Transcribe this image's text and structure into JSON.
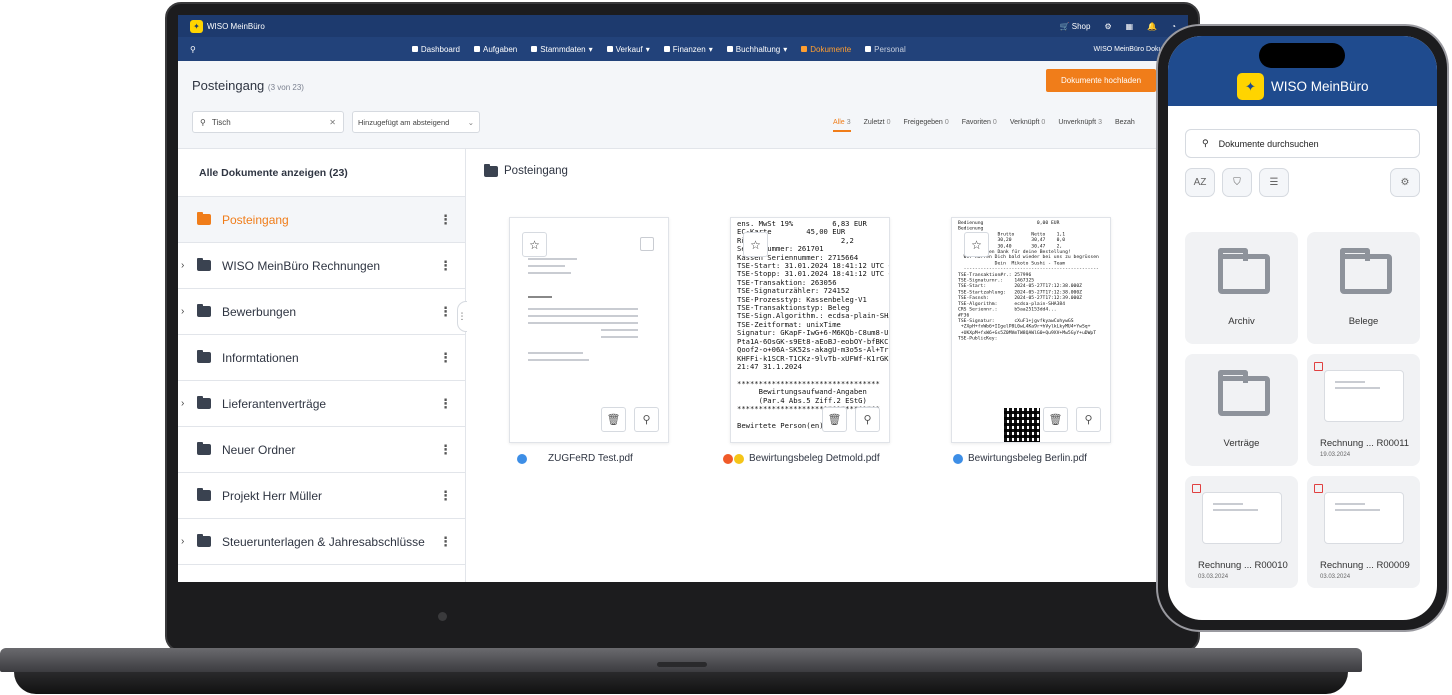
{
  "app": {
    "brand": "WISO MeinBüro",
    "shop": "Shop",
    "notif_count": "3"
  },
  "nav": {
    "items": [
      {
        "label": "Dashboard"
      },
      {
        "label": "Aufgaben"
      },
      {
        "label": "Stammdaten"
      },
      {
        "label": "Verkauf"
      },
      {
        "label": "Finanzen"
      },
      {
        "label": "Buchhaltung"
      },
      {
        "label": "Dokumente"
      },
      {
        "label": "Personal"
      }
    ],
    "right_label": "WISO MeinBüro Dokumen"
  },
  "header": {
    "title": "Posteingang",
    "count": "(3 von 23)",
    "upload_label": "Dokumente hochladen",
    "search_value": "Tisch",
    "sort_value": "Hinzugefügt am absteigend",
    "filters": [
      {
        "label": "Alle",
        "count": "3"
      },
      {
        "label": "Zuletzt",
        "count": "0"
      },
      {
        "label": "Freigegeben",
        "count": "0"
      },
      {
        "label": "Favoriten",
        "count": "0"
      },
      {
        "label": "Verknüpft",
        "count": "0"
      },
      {
        "label": "Unverknüpft",
        "count": "3"
      },
      {
        "label": "Bezah",
        "count": ""
      }
    ]
  },
  "folders": {
    "all_label": "Alle Dokumente anzeigen (23)",
    "items": [
      {
        "label": "Posteingang"
      },
      {
        "label": "WISO MeinBüro Rechnungen"
      },
      {
        "label": "Bewerbungen"
      },
      {
        "label": "Informtationen"
      },
      {
        "label": "Lieferantenverträge"
      },
      {
        "label": "Neuer Ordner"
      },
      {
        "label": "Projekt Herr Müller"
      },
      {
        "label": "Steuerunterlagen & Jahresabschlüsse"
      }
    ]
  },
  "documents": {
    "breadcrumb": "Posteingang",
    "items": [
      {
        "name": "ZUGFeRD Test.pdf",
        "tag_colors": [
          "#3d8ee6"
        ]
      },
      {
        "name": "Bewirtungsbeleg Detmold.pdf",
        "tag_colors": [
          "#f05a28",
          "#f5c518"
        ]
      },
      {
        "name": "Bewirtungsbeleg Berlin.pdf",
        "tag_colors": [
          "#3d8ee6"
        ]
      }
    ],
    "receipt1": "ens. MwSt 19%         6,83 EUR\nEC-Karte        45,00 EUR\nRü                      2,2\nSeriennummer: 261701\nKassen Seriennummer: 2715664\nTSE-Start: 31.01.2024 18:41:12 UTC +1:00\nTSE-Stopp: 31.01.2024 18:41:12 UTC +1:00\nTSE-Transaktion: 263056\nTSE-Signaturzähler: 724152\nTSE-Prozesstyp: Kassenbeleg-V1\nTSE-Transaktionstyp: Beleg\nTSE-Sign.Algorithm.: ecdsa-plain-SHA384\nTSE-Zeitformat: unixTime\nSignatur: GKapF-IwG+6-M6KQb-C8um8-Ucb1/-\nPta1A-6OsGK-s9Et8-aEoBJ-eobOY-bfBKC-nXKdF-\nQoof2-o+06A-SK52s-akagU-m3o5s-Al+Tr-UoFDY-\nKHFFi-k1SCR-T1CKz-9lvTb-xUFWf-K1rGK-3KN\n21:47 31.1.2024\n\n*********************************\n     Bewirtungsaufwand-Angaben\n     (Par.4 Abs.5 Ziff.2 EStG)\n*********************************\n\nBewirtete Person(en):",
    "receipt2": "Bedienung                   0,00 EUR\nBedienung\n              Brutto      Netto    1,1\n              30,20       30,47    0,0\n              30,40       30,47    2,\n       Vielen Dank für deine Bestellung!\n  Wir hoffen Dich bald wieder bei uns zu begrüssen\n             Dein  Mikoto Sushi - Team\n  ------------------------------------------------\nTSE-Transaktion#r.: 257996\nTSE-Signaturnr.:    1467325\nTSE-Start:          2024-05-27T17:12:38.000Z\nTSE-Startzahlung:   2024-05-27T17:12:38.000Z\nTSE-Fasnsh:         2024-05-27T17:12:39.000Z\nTSE-Algorithm:      ecdsa-plain-SHA384\nCRS Seriennr.:      b5aa25153dd4...\n#F36\nTSE-Signatur:       cXuF1+jgvfkyawCohywGS\n +ZXpH+fxWb6+IIgelP8L0wL4Ka9r+hVylkLkyMU4+YwSq+\n +UKXpM+fxW6+Gs5Z0MVmTW8QAWlG0+Qu9XV+Mw5GyY+uDWpT\nTSE-PublicKey:"
  },
  "phone": {
    "brand": "WISO MeinBüro",
    "search_placeholder": "Dokumente durchsuchen",
    "folders": [
      {
        "label": "Archiv"
      },
      {
        "label": "Belege"
      },
      {
        "label": "Verträge"
      }
    ],
    "docs": [
      {
        "label": "Rechnung ... R00011",
        "date": "19.03.2024"
      },
      {
        "label": "Rechnung ... R00010",
        "date": "03.03.2024"
      },
      {
        "label": "Rechnung ... R00009",
        "date": "03.03.2024"
      }
    ]
  }
}
